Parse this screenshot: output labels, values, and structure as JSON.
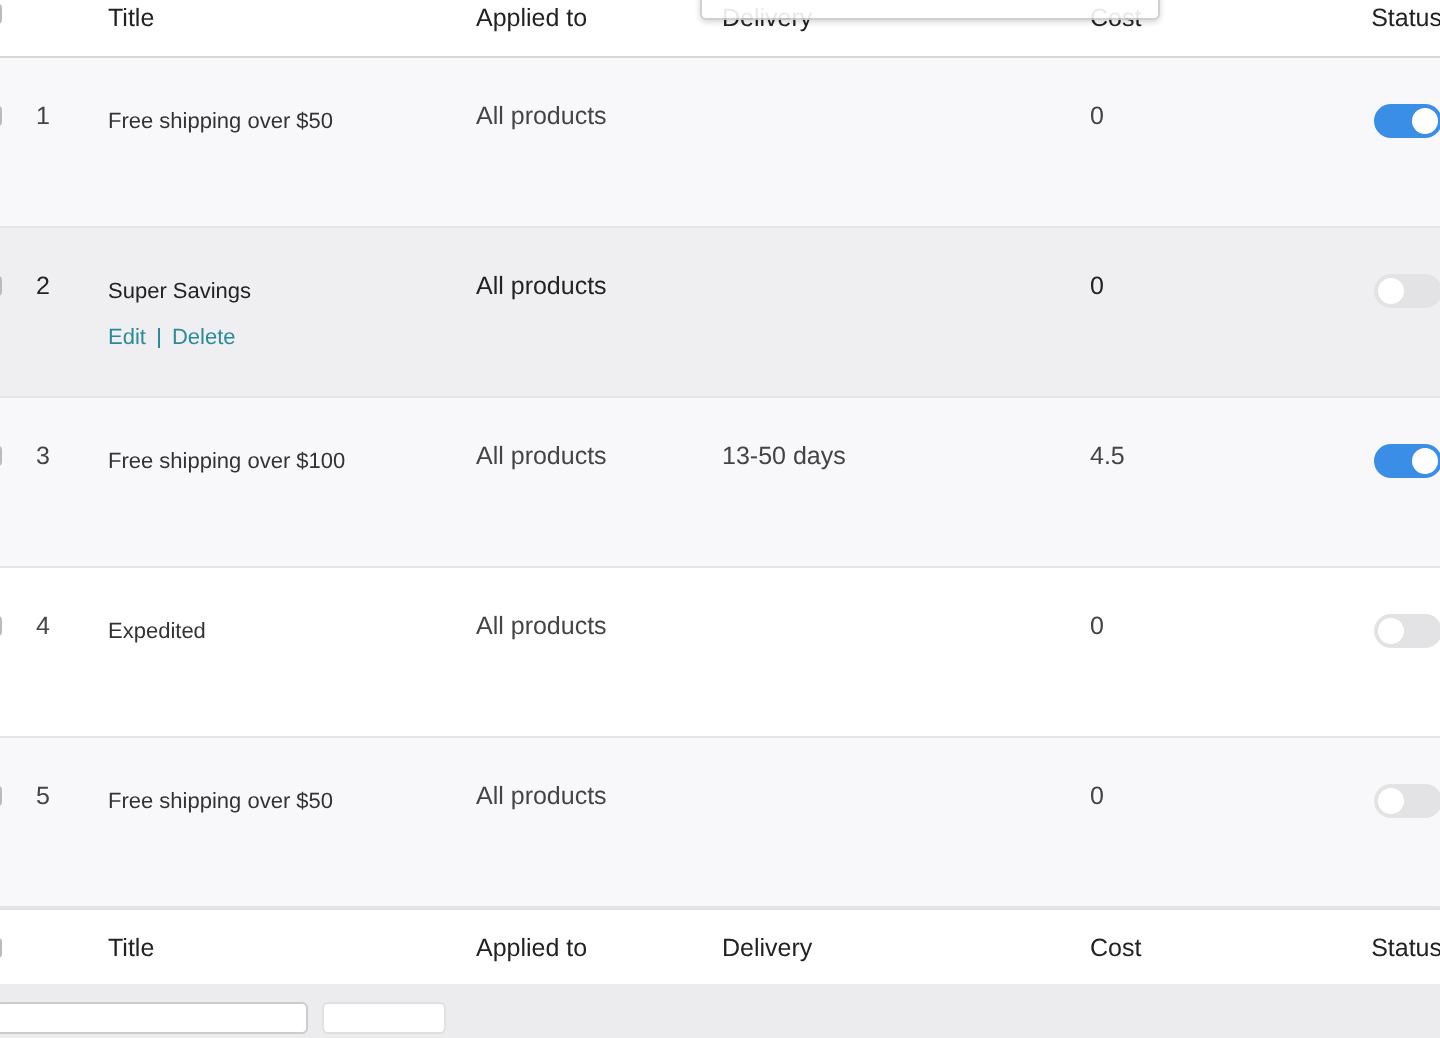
{
  "table": {
    "select_all_checked": false,
    "columns": [
      "Title",
      "Applied to",
      "Delivery",
      "Cost",
      "Status"
    ],
    "rows": [
      {
        "checked": false,
        "index": "1",
        "title": "Free shipping over $50",
        "applied_to": "All products",
        "delivery": "",
        "cost": "0",
        "enabled": true,
        "hovered": false
      },
      {
        "checked": false,
        "index": "2",
        "title": "Super Savings",
        "applied_to": "All products",
        "delivery": "",
        "cost": "0",
        "enabled": false,
        "hovered": true,
        "actions": [
          "Edit",
          "Delete"
        ]
      },
      {
        "checked": false,
        "index": "3",
        "title": "Free shipping over $100",
        "applied_to": "All products",
        "delivery": "13-50 days",
        "cost": "4.5",
        "enabled": true,
        "hovered": false
      },
      {
        "checked": false,
        "index": "4",
        "title": "Expedited",
        "applied_to": "All products",
        "delivery": "",
        "cost": "0",
        "enabled": false,
        "hovered": false
      },
      {
        "checked": false,
        "index": "5",
        "title": "Free shipping over $50",
        "applied_to": "All products",
        "delivery": "",
        "cost": "0",
        "enabled": false,
        "hovered": false
      }
    ],
    "footer_select_all_checked": false,
    "footer_columns": [
      "Title",
      "Applied to",
      "Delivery",
      "Cost",
      "Status"
    ]
  }
}
